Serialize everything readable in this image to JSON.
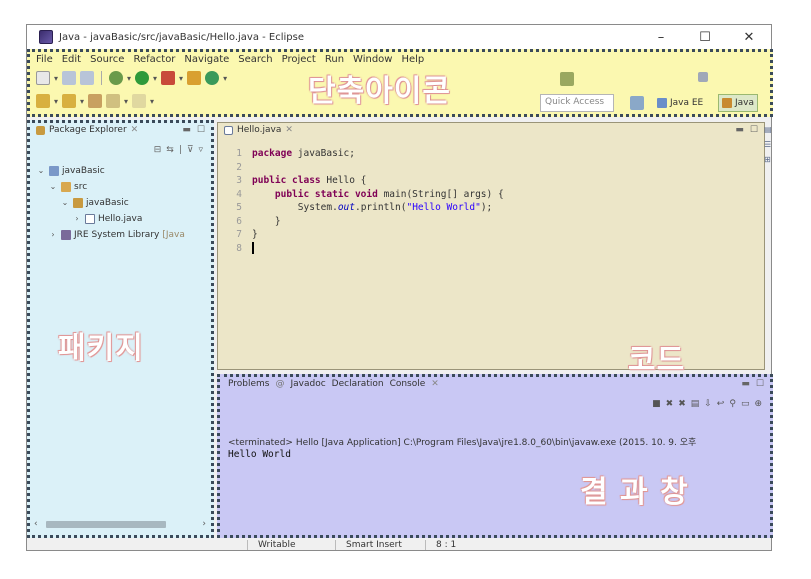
{
  "window": {
    "title": "Java - javaBasic/src/javaBasic/Hello.java - Eclipse",
    "controls": [
      "–",
      "☐",
      "✕"
    ]
  },
  "menu": [
    "File",
    "Edit",
    "Source",
    "Refactor",
    "Navigate",
    "Search",
    "Project",
    "Run",
    "Window",
    "Help"
  ],
  "labels": {
    "shortcut_icons": "단축아이콘",
    "package": "패키지",
    "code": "코드",
    "result": "결 과 창"
  },
  "toolbar": {
    "quick_access": "Quick Access",
    "perspectives": [
      "Java EE",
      "Java"
    ]
  },
  "package_explorer": {
    "tab_label": "Package Explorer",
    "tree": [
      {
        "label": "javaBasic",
        "decoration": ""
      },
      {
        "label": "src",
        "decoration": ""
      },
      {
        "label": "javaBasic",
        "decoration": ""
      },
      {
        "label": "Hello.java",
        "decoration": ""
      },
      {
        "label": "JRE System Library",
        "decoration": "[Java"
      }
    ]
  },
  "editor": {
    "tab_label": "Hello.java",
    "line_numbers": [
      "1",
      "2",
      "3",
      "4",
      "5",
      "6",
      "7",
      "8"
    ],
    "lines": {
      "l1_kw": "package",
      "l1_rest": " javaBasic;",
      "l3_kw": "public class",
      "l3_rest": " Hello {",
      "l4_kw": "public static void",
      "l4_rest": " main(String[] args) {",
      "l5_pre": "System.",
      "l5_field": "out",
      "l5_mid": ".println(",
      "l5_str": "\"Hello World\"",
      "l5_end": ");",
      "l6": "}",
      "l7": "}"
    }
  },
  "console": {
    "tabs": [
      "Problems",
      "Javadoc",
      "Declaration",
      "Console"
    ],
    "terminated": "<terminated> Hello [Java Application] C:\\Program Files\\Java\\jre1.8.0_60\\bin\\javaw.exe (2015. 10. 9. 오후",
    "output": "Hello World"
  },
  "status": {
    "mode": "Writable",
    "insert": "Smart Insert",
    "position": "8 : 1"
  },
  "colors": {
    "shortcut_zone": "#fbf8b0",
    "package_zone": "#dbf1f8",
    "code_zone": "#ece6c8",
    "result_zone": "#c9c8f4"
  }
}
